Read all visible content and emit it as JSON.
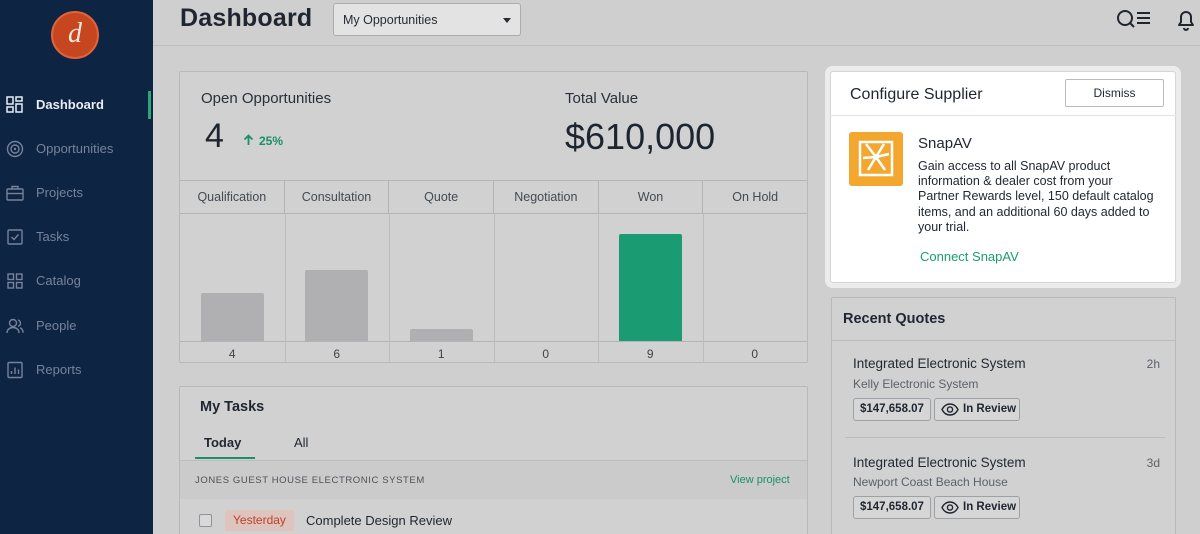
{
  "app": {
    "logo_letter": "d"
  },
  "sidebar": {
    "items": [
      {
        "label": "Dashboard",
        "icon": "dashboard-icon",
        "active": true
      },
      {
        "label": "Opportunities",
        "icon": "target-icon"
      },
      {
        "label": "Projects",
        "icon": "briefcase-icon"
      },
      {
        "label": "Tasks",
        "icon": "checkbox-icon"
      },
      {
        "label": "Catalog",
        "icon": "catalog-icon"
      },
      {
        "label": "People",
        "icon": "people-icon"
      },
      {
        "label": "Reports",
        "icon": "reports-icon"
      }
    ]
  },
  "header": {
    "title": "Dashboard",
    "filter_value": "My Opportunities",
    "icons": [
      "search-list-icon",
      "bell-icon"
    ]
  },
  "summary": {
    "open_label": "Open Opportunities",
    "open_value": "4",
    "trend": "25%",
    "trend_direction": "up",
    "total_label": "Total Value",
    "total_value": "$610,000"
  },
  "pipeline": {
    "stages": [
      "Qualification",
      "Consultation",
      "Quote",
      "Negotiation",
      "Won",
      "On Hold"
    ],
    "counts": [
      "4",
      "6",
      "1",
      "0",
      "9",
      "0"
    ],
    "highlight_stage": "Won",
    "colors": {
      "default": "#b0b0b2",
      "highlight": "#1a9b72"
    }
  },
  "tasks": {
    "title": "My Tasks",
    "tabs": [
      "Today",
      "All"
    ],
    "active_tab": "Today",
    "group_label": "JONES GUEST HOUSE ELECTRONIC SYSTEM",
    "view_project": "View project",
    "items": [
      {
        "due": "Yesterday",
        "name": "Complete Design Review"
      }
    ]
  },
  "configure": {
    "title": "Configure Supplier",
    "dismiss": "Dismiss",
    "supplier_name": "SnapAV",
    "description": "Gain access to all SnapAV product information & dealer cost from your Partner Rewards level, 150 default catalog items, and an additional 60 days added to your trial.",
    "cta": "Connect SnapAV",
    "accent": "#f4a72e"
  },
  "quotes": {
    "title": "Recent Quotes",
    "items": [
      {
        "name": "Integrated Electronic System",
        "client": "Kelly Electronic System",
        "age": "2h",
        "amount": "$147,658.07",
        "status": "In Review"
      },
      {
        "name": "Integrated Electronic System",
        "client": "Newport Coast Beach House",
        "age": "3d",
        "amount": "$147,658.07",
        "status": "In Review"
      }
    ]
  }
}
